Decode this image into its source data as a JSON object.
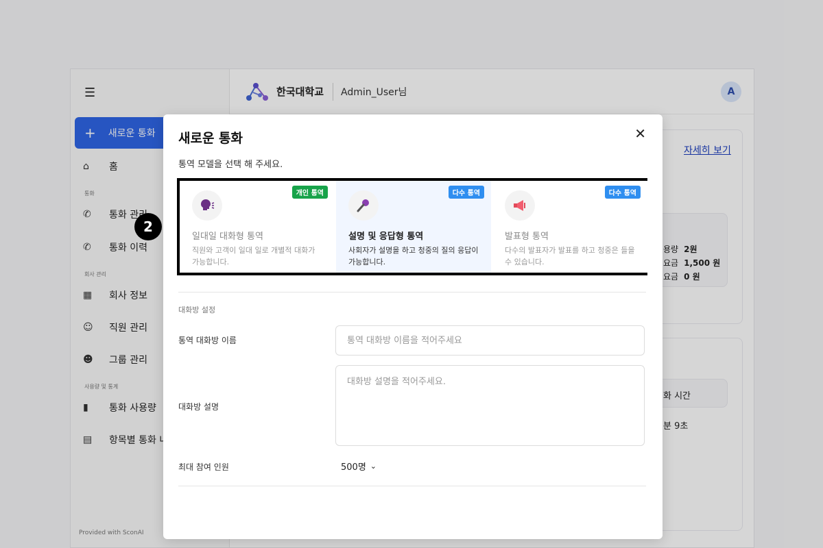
{
  "sidebar": {
    "new_call": "새로운 통화",
    "home": "홈",
    "section_call": "통화",
    "call_manage": "통화 관리",
    "call_history": "통화 이력",
    "section_company": "회사 관리",
    "company_info": "회사 정보",
    "staff_manage": "직원 관리",
    "group_manage": "그룹 관리",
    "section_usage": "사용량 및 통계",
    "call_usage": "통화 사용량",
    "item_call": "항목별 통화 내",
    "provided": "Provided with SconAI"
  },
  "topbar": {
    "org": "한국대학교",
    "user": "Admin_User님",
    "avatar": "A"
  },
  "background": {
    "detail_link": "자세히 보기",
    "stats": [
      {
        "label": "용량",
        "value": "2원"
      },
      {
        "label": "요금",
        "value": "1,500 원"
      },
      {
        "label": "요금",
        "value": "0 원"
      }
    ],
    "col_header": "화 시간",
    "duration": "분 9초"
  },
  "modal": {
    "title": "새로운 통화",
    "subtitle": "통역 모델을 선택 해 주세요.",
    "cards": [
      {
        "badge": "개인 통역",
        "title": "일대일 대화형 통역",
        "desc": "직원와 고객이 일대 일로 개별적 대화가 가능합니다."
      },
      {
        "badge": "다수 통역",
        "title": "설명 및 응답형 통역",
        "desc": "사회자가 설명을 하고 청중의 질의 응답이 가능합니다."
      },
      {
        "badge": "다수 통역",
        "title": "발표형 통역",
        "desc": "다수의 발표자가 발표를 하고 청중은 들을 수 있습니다."
      }
    ],
    "section_label": "대화방 설정",
    "room_name_label": "통역 대화방 이름",
    "room_name_placeholder": "통역 대화방 이름을 적어주세요",
    "room_desc_label": "대화방 설명",
    "room_desc_placeholder": "대화방 설명을 적어주세요.",
    "max_label": "최대 참여 인원",
    "max_value": "500명"
  },
  "step_marker": "2",
  "colors": {
    "accent": "#2f66e6",
    "badge_green": "#18a34a",
    "badge_blue": "#2f8ef0"
  }
}
